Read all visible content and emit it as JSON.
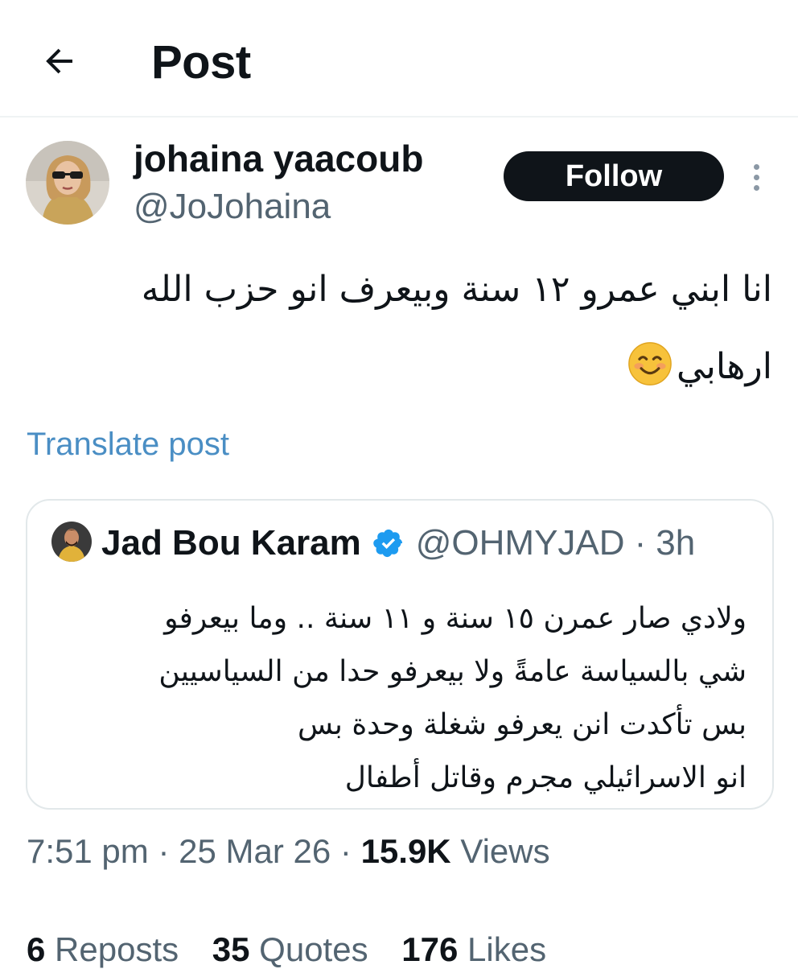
{
  "header": {
    "title": "Post",
    "back_icon": "arrow-left-icon"
  },
  "post": {
    "author_name": "johaina yaacoub",
    "author_handle": "@JoJohaina",
    "follow_label": "Follow",
    "text_line1": "انا ابني عمرو ١٢ سنة وبيعرف انو حزب الله",
    "text_line2": "ارهابي",
    "emoji": "smiling-face-emoji",
    "translate_label": "Translate post"
  },
  "quote": {
    "author_name": "Jad Bou Karam",
    "verified_icon": "verified-badge-icon",
    "handle": "@OHMYJAD",
    "separator": "·",
    "time": "3h",
    "lines": [
      "ولادي صار عمرن ١٥ سنة و ١١ سنة .. وما بيعرفو",
      "شي بالسياسة عامةً ولا بيعرفو حدا من السياسيين",
      "بس تأكدت انن يعرفو شغلة وحدة بس",
      "انو الاسرائيلي مجرم وقاتل أطفال"
    ]
  },
  "meta": {
    "time": "7:51 pm",
    "sep1": "·",
    "date": "25 Mar 26",
    "sep2": "·",
    "views_count": "15.9K",
    "views_label": "Views"
  },
  "stats": {
    "reposts_count": "6",
    "reposts_label": "Reposts",
    "quotes_count": "35",
    "quotes_label": "Quotes",
    "likes_count": "176",
    "likes_label": "Likes"
  },
  "colors": {
    "text": "#0f1419",
    "secondary": "#536471",
    "link": "#4a8ec4",
    "verified": "#1d9bf0",
    "follow_bg": "#0f1419"
  }
}
